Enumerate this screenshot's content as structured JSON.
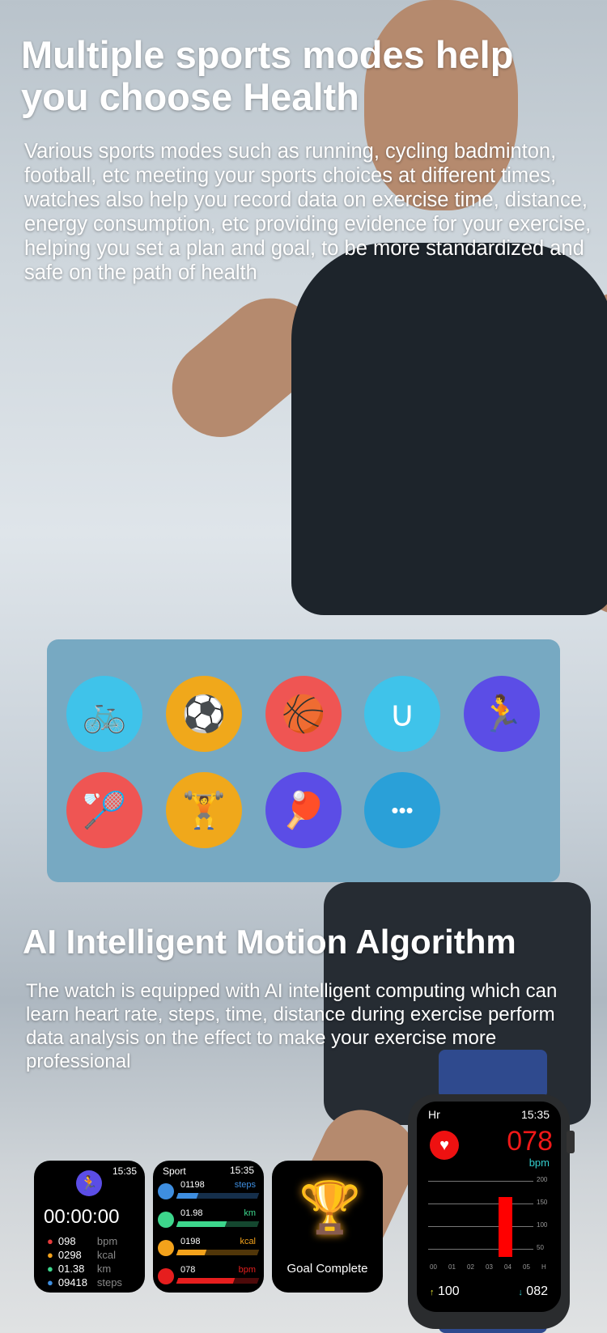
{
  "hero": {
    "title": "Multiple sports modes help you choose Health",
    "body": "Various sports modes such as running, cycling badminton, football, etc meeting your sports choices at different times, watches also help you record data on exercise time, distance, energy consumption, etc providing evidence for your exercise, helping you set a plan and goal, to be more standardized and safe on the path of health"
  },
  "sports_icons": [
    {
      "name": "cycling-icon",
      "color": "#3fc3ea",
      "glyph": "🚲"
    },
    {
      "name": "football-icon",
      "color": "#f0a81b",
      "glyph": "⚽"
    },
    {
      "name": "basketball-icon",
      "color": "#ef5553",
      "glyph": "🏀"
    },
    {
      "name": "jump-rope-icon",
      "color": "#3fc3ea",
      "glyph": "∪"
    },
    {
      "name": "running-icon",
      "color": "#5b4de6",
      "glyph": "🏃"
    },
    {
      "name": "badminton-icon",
      "color": "#ef5553",
      "glyph": "🏸"
    },
    {
      "name": "dumbbell-icon",
      "color": "#f0a81b",
      "glyph": "🏋"
    },
    {
      "name": "table-tennis-icon",
      "color": "#5b4de6",
      "glyph": "🏓"
    },
    {
      "name": "more-icon",
      "color": "#2aa0d8",
      "glyph": "•••"
    }
  ],
  "ai": {
    "title": "AI Intelligent Motion Algorithm",
    "body": "The watch is equipped with AI intelligent computing which can learn heart rate, steps, time, distance during exercise perform data analysis on the effect to make your exercise more professional"
  },
  "watch1": {
    "time": "15:35",
    "timer": "00:00:00",
    "rows": [
      {
        "value": "098",
        "unit": "bpm",
        "color": "#e63b3b"
      },
      {
        "value": "0298",
        "unit": "kcal",
        "color": "#f3a21b"
      },
      {
        "value": "01.38",
        "unit": "km",
        "color": "#3dd68c"
      },
      {
        "value": "09418",
        "unit": "steps",
        "color": "#3e8ee0"
      }
    ]
  },
  "watch2": {
    "title": "Sport",
    "time": "15:35",
    "rows": [
      {
        "value": "01198",
        "unit": "steps",
        "color": "#3e8ee0",
        "progress": 0.25
      },
      {
        "value": "01.98",
        "unit": "km",
        "color": "#3dd68c",
        "progress": 0.6
      },
      {
        "value": "0198",
        "unit": "kcal",
        "color": "#f3a21b",
        "progress": 0.35
      },
      {
        "value": "078",
        "unit": "bpm",
        "color": "#e61e1e",
        "progress": 0.7
      }
    ]
  },
  "watch3": {
    "label": "Goal Complete"
  },
  "watch4": {
    "title": "Hr",
    "time": "15:35",
    "bpm": "078",
    "unit": "bpm",
    "y_ticks": [
      "200",
      "150",
      "100",
      "50"
    ],
    "x_ticks": [
      "00",
      "01",
      "02",
      "03",
      "04",
      "05",
      "H"
    ],
    "max": "100",
    "min": "082"
  }
}
